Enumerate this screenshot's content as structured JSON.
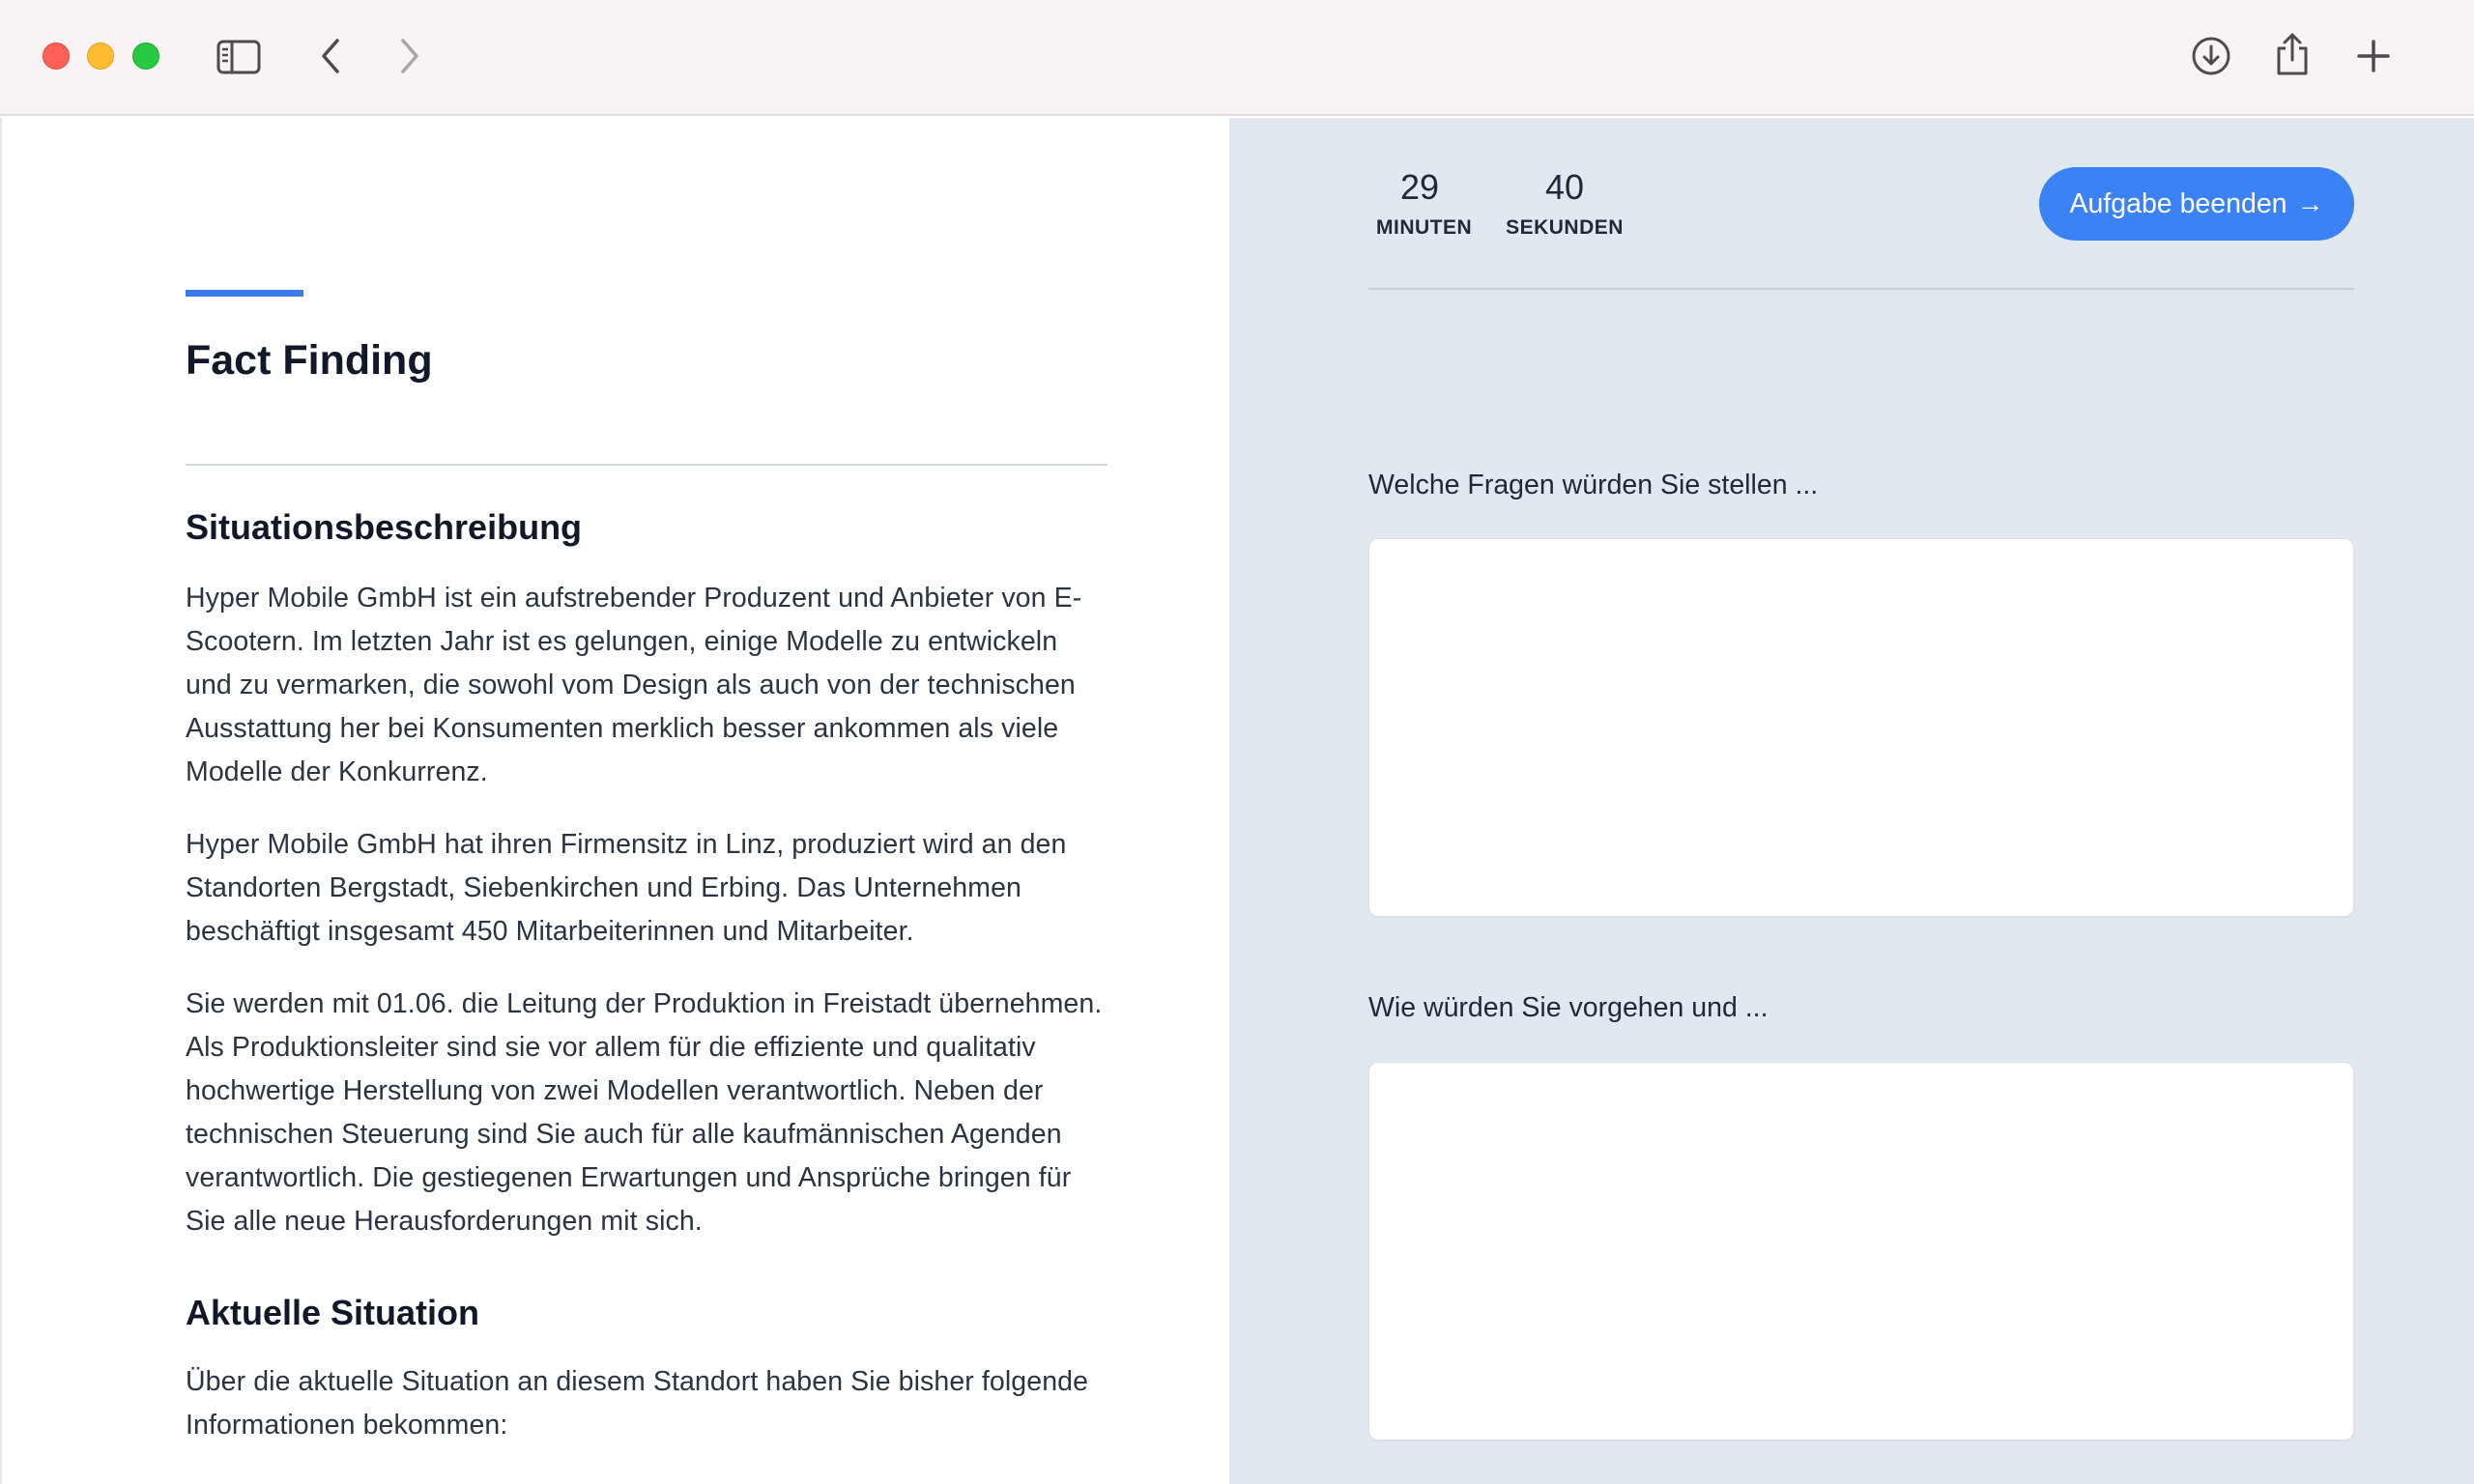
{
  "browser": {
    "icons": {
      "sidebar": "sidebar-toggle-icon",
      "back": "chevron-left-icon",
      "forward": "chevron-right-icon",
      "download": "download-icon",
      "share": "share-icon",
      "new_tab": "plus-icon"
    }
  },
  "task": {
    "title": "Fact Finding",
    "sections": [
      {
        "heading": "Situationsbeschreibung",
        "paragraphs": [
          "Hyper Mobile GmbH ist ein aufstrebender Produzent und Anbieter von E-Scootern. Im letzten Jahr ist es gelungen, einige Modelle zu entwickeln und zu vermarken, die sowohl vom Design als auch von der technischen Ausstattung her bei Konsumenten merklich besser ankommen als viele Modelle der Konkurrenz.",
          "Hyper Mobile GmbH hat ihren Firmensitz in Linz, produziert wird an den Standorten Bergstadt, Siebenkirchen und Erbing. Das Unternehmen beschäftigt insgesamt 450 Mitarbeiterinnen und Mitarbeiter.",
          "Sie werden mit 01.06. die Leitung der Produktion in Freistadt übernehmen. Als Produktionsleiter sind sie vor allem für die effiziente und qualitativ hochwertige Herstellung von zwei Modellen verantwortlich. Neben der technischen Steuerung sind Sie auch für alle kaufmännischen Agenden verantwortlich. Die gestiegenen Erwartungen und Ansprüche bringen für Sie alle neue Herausforderungen mit sich."
        ]
      },
      {
        "heading": "Aktuelle Situation",
        "paragraphs": [
          "Über die aktuelle Situation an diesem Standort haben Sie bisher folgende Informationen bekommen:"
        ]
      }
    ]
  },
  "timer": {
    "minutes": "29",
    "minutes_label": "MINUTEN",
    "seconds": "40",
    "seconds_label": "SEKUNDEN"
  },
  "finish_button": {
    "label": "Aufgabe beenden",
    "arrow": "→"
  },
  "questions": [
    {
      "label": "Welche Fragen würden Sie stellen ...",
      "value": ""
    },
    {
      "label": "Wie würden Sie vorgehen und ...",
      "value": ""
    }
  ],
  "colors": {
    "accent": "#3b7ae8",
    "button": "#3b82f6",
    "right_pane_bg": "#e1e8f0",
    "titlebar_bg": "#faf3f5"
  }
}
